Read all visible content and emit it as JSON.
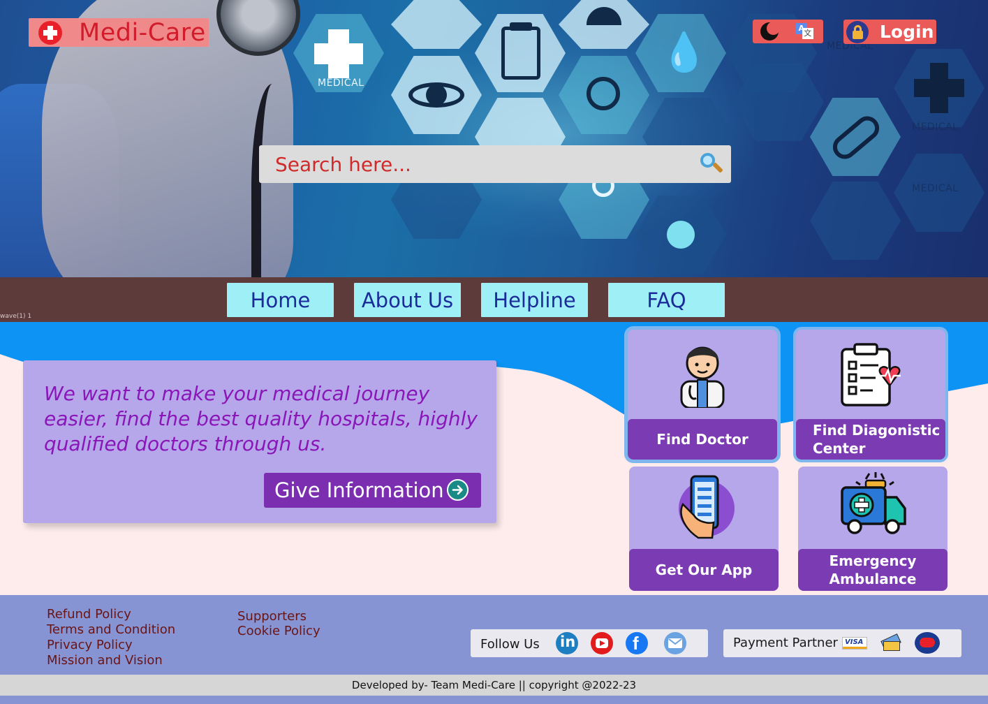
{
  "brand": {
    "name": "Medi-Care"
  },
  "header": {
    "theme_icon": "moon-icon",
    "translate_icon": "translate-icon",
    "login_label": "Login",
    "search_placeholder": "Search here..."
  },
  "hero_image": {
    "tags": [
      "MEDICAL",
      "MEDICAL",
      "MEDICAL",
      "MEDICAL"
    ]
  },
  "nav": {
    "items": [
      {
        "label": "Home"
      },
      {
        "label": "About Us"
      },
      {
        "label": "Helpline"
      },
      {
        "label": "FAQ"
      }
    ],
    "wave_caption": "wave(1) 1"
  },
  "main": {
    "mission_text": "We want to make your medical journey easier, find the best quality hospitals, highly qualified doctors through us.",
    "give_info_label": "Give Information",
    "services": [
      {
        "label": "Find Doctor",
        "icon": "doctor-icon"
      },
      {
        "label": "Find Diagonistic Center",
        "icon": "clipboard-heartbeat-icon"
      },
      {
        "label": "Get Our App",
        "icon": "smartphone-icon"
      },
      {
        "label": "Emergency Ambulance",
        "icon": "ambulance-icon"
      }
    ]
  },
  "footer": {
    "col1": [
      "Refund Policy",
      "Terms and Condition",
      "Privacy Policy",
      "Mission and Vision"
    ],
    "col2": [
      "Supporters",
      "Cookie Policy"
    ],
    "follow_label": "Follow Us",
    "social": [
      "linkedin-icon",
      "youtube-icon",
      "facebook-icon",
      "mail-icon"
    ],
    "payment_label": "Payment Partner",
    "payment": [
      "visa-icon",
      "card-icon",
      "mastercard-icon"
    ],
    "copyright": "Developed by- Team Medi-Care || copyright @2022-23"
  },
  "colors": {
    "nav_bg": "#5e3b3b",
    "nav_button": "#9ff0f6",
    "accent_purple": "#7b3bb2",
    "card_lavender": "#b5a7ea",
    "footer_bg": "#8794d4",
    "logo_red": "#d31c2b"
  }
}
